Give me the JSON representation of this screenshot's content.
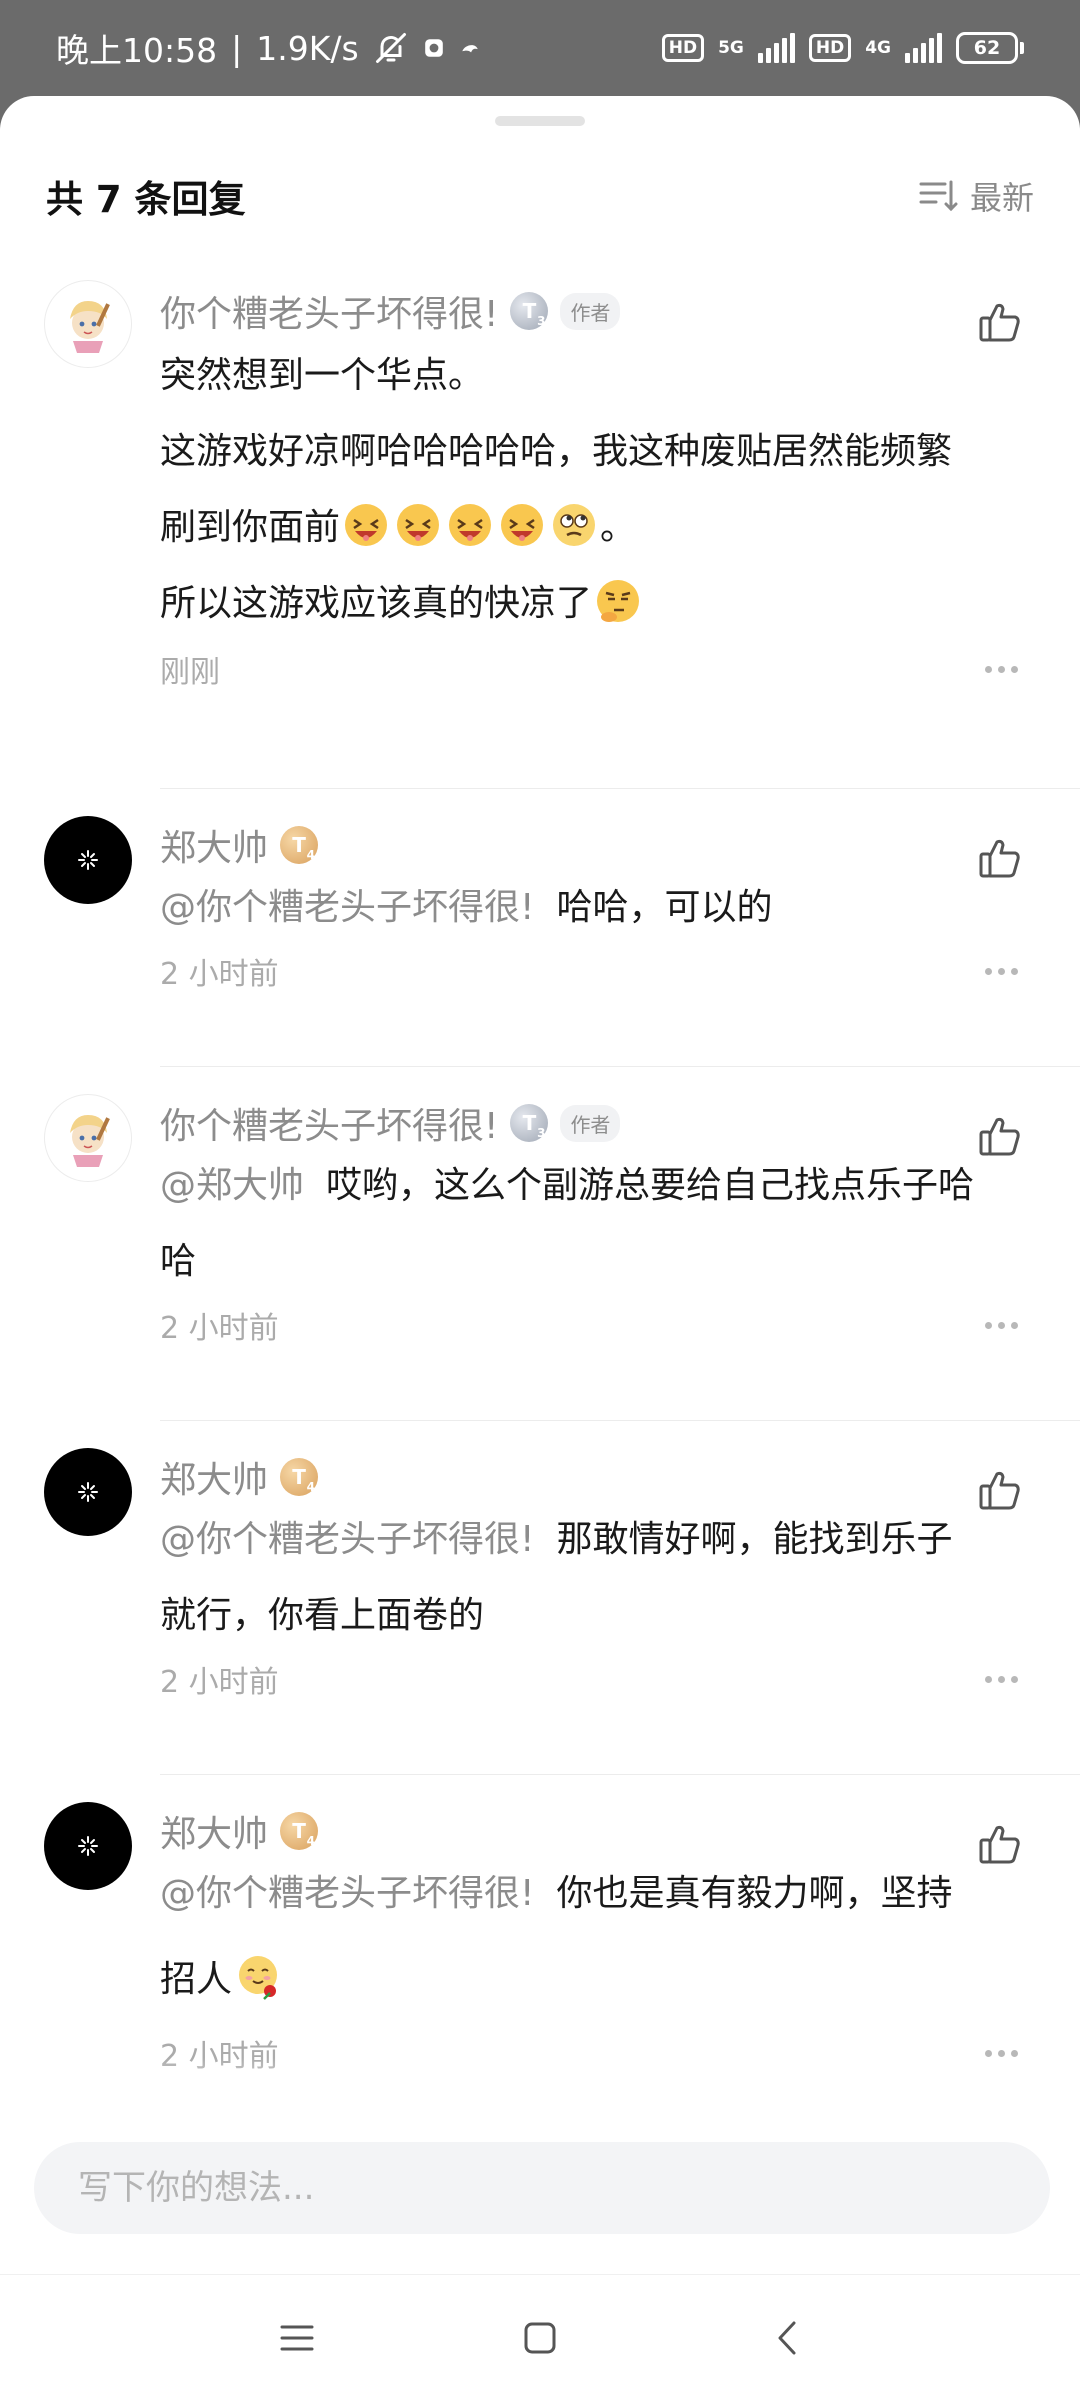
{
  "status_bar": {
    "time": "晚上10:58",
    "separator": "|",
    "net_speed": "1.9K/s",
    "hd_label_1": "HD",
    "net_type_1": "5G",
    "hd_label_2": "HD",
    "net_type_2": "4G",
    "battery": "62"
  },
  "header": {
    "reply_count": "共 7 条回复",
    "sort_label": "最新"
  },
  "comments": [
    {
      "name": "你个糟老头子坏得很!",
      "badge": "T",
      "badge_sub": "3",
      "author_tag": "作者",
      "lines": [
        "突然想到一个华点。",
        "这游戏好凉啊哈哈哈哈哈，我这种废贴居然能频繁",
        "刷到你面前",
        "。",
        "所以这游戏应该真的快凉了"
      ],
      "time": "刚刚"
    },
    {
      "name": "郑大帅",
      "badge": "T",
      "badge_sub": "4",
      "mention": "@你个糟老头子坏得很!",
      "text": "哈哈，可以的",
      "time": "2 小时前"
    },
    {
      "name": "你个糟老头子坏得很!",
      "badge": "T",
      "badge_sub": "3",
      "author_tag": "作者",
      "mention": "@郑大帅",
      "text": "哎哟，这么个副游总要给自己找点乐子哈",
      "text_2": "哈",
      "time": "2 小时前"
    },
    {
      "name": "郑大帅",
      "badge": "T",
      "badge_sub": "4",
      "mention": "@你个糟老头子坏得很!",
      "text": "那敢情好啊，能找到乐子",
      "text_2": "就行，你看上面卷的",
      "time": "2 小时前"
    },
    {
      "name": "郑大帅",
      "badge": "T",
      "badge_sub": "4",
      "mention": "@你个糟老头子坏得很!",
      "text": "你也是真有毅力啊，坚持",
      "text_2": "招人",
      "time": "2 小时前"
    }
  ],
  "input": {
    "placeholder": "写下你的想法..."
  },
  "icons": {
    "like": "thumbs-up-icon",
    "more": "more-dots-icon",
    "sort": "sort-lines-icon",
    "nav_menu": "menu-lines-icon",
    "nav_home": "home-square-icon",
    "nav_back": "back-chevron-icon"
  },
  "colors": {
    "status_bar": "#6b6b6b",
    "name_gray": "#8c8c8c",
    "time_gray": "#ababab"
  }
}
